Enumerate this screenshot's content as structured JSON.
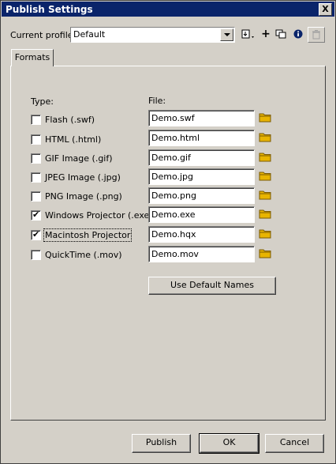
{
  "window": {
    "title": "Publish Settings",
    "close_glyph": "X"
  },
  "profile": {
    "label": "Current profile:",
    "value": "Default"
  },
  "toolbar": {
    "icons": [
      "import-export-icon",
      "add-profile-icon",
      "duplicate-profile-icon",
      "profile-info-icon",
      "delete-profile-icon"
    ],
    "add_glyph": "+",
    "info_glyph": "i"
  },
  "tabs": [
    {
      "label": "Formats",
      "selected": true
    }
  ],
  "formats": {
    "type_header": "Type:",
    "file_header": "File:",
    "rows": [
      {
        "label": "Flash  (.swf)",
        "checked": false,
        "file": "Demo.swf"
      },
      {
        "label": "HTML  (.html)",
        "checked": false,
        "file": "Demo.html"
      },
      {
        "label": "GIF Image (.gif)",
        "checked": false,
        "file": "Demo.gif"
      },
      {
        "label": "JPEG Image (.jpg)",
        "checked": false,
        "file": "Demo.jpg"
      },
      {
        "label": "PNG Image (.png)",
        "checked": false,
        "file": "Demo.png"
      },
      {
        "label": "Windows Projector (.exe)",
        "checked": true,
        "file": "Demo.exe"
      },
      {
        "label": "Macintosh Projector",
        "checked": true,
        "file": "Demo.hqx"
      },
      {
        "label": "QuickTime (.mov)",
        "checked": false,
        "file": "Demo.mov"
      }
    ],
    "use_default_names": "Use Default Names"
  },
  "buttons": {
    "publish": "Publish",
    "ok": "OK",
    "cancel": "Cancel"
  },
  "colors": {
    "titlebar": "#0a246a",
    "face": "#d4d0c8",
    "folder": "#e8b400"
  }
}
